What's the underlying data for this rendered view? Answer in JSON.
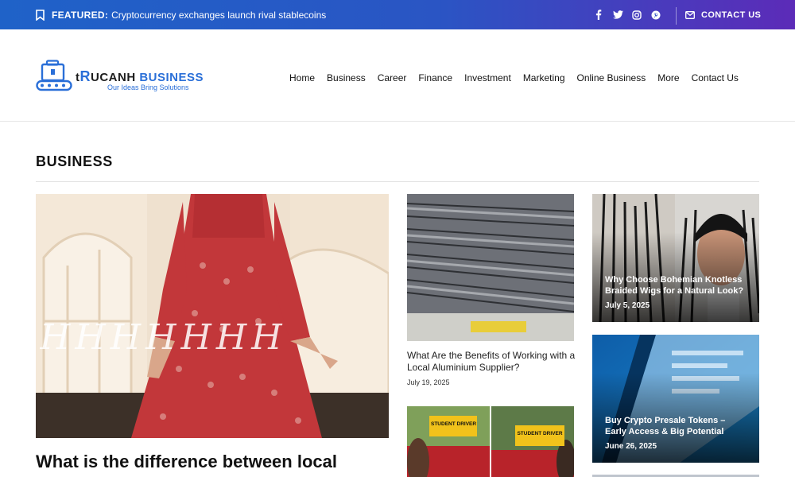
{
  "topbar": {
    "featured_label": "FEATURED:",
    "featured_text": "Cryptocurrency exchanges launch rival stablecoins",
    "contact_label": "CONTACT US",
    "social": [
      "facebook-icon",
      "twitter-icon",
      "instagram-icon",
      "pinterest-icon"
    ]
  },
  "logo": {
    "t": "t",
    "r": "R",
    "rest": "UCANH",
    "biz": " BUSINESS",
    "tagline": "Our Ideas Bring Solutions"
  },
  "nav": {
    "items": [
      "Home",
      "Business",
      "Career",
      "Finance",
      "Investment",
      "Marketing",
      "Online Business",
      "More",
      "Contact Us"
    ]
  },
  "section": {
    "title": "BUSINESS"
  },
  "feature": {
    "title": "What is the difference between local",
    "watermark": "HHHHHHH"
  },
  "mid": {
    "title": "What Are the Benefits of Working with a Local Aluminium Supplier?",
    "date": "July 19, 2025",
    "sign1": "STUDENT DRIVER",
    "sign2": "STUDENT DRIVER"
  },
  "cards": [
    {
      "title": "Why Choose Bohemian Knotless Braided Wigs for a Natural Look?",
      "date": "July 5, 2025"
    },
    {
      "title": "Buy Crypto Presale Tokens – Early Access & Big Potential",
      "date": "June 26, 2025"
    }
  ],
  "colors": {
    "accent": "#2a6fd8",
    "topbar_start": "#1f62c8",
    "topbar_end": "#5c2bb8"
  }
}
